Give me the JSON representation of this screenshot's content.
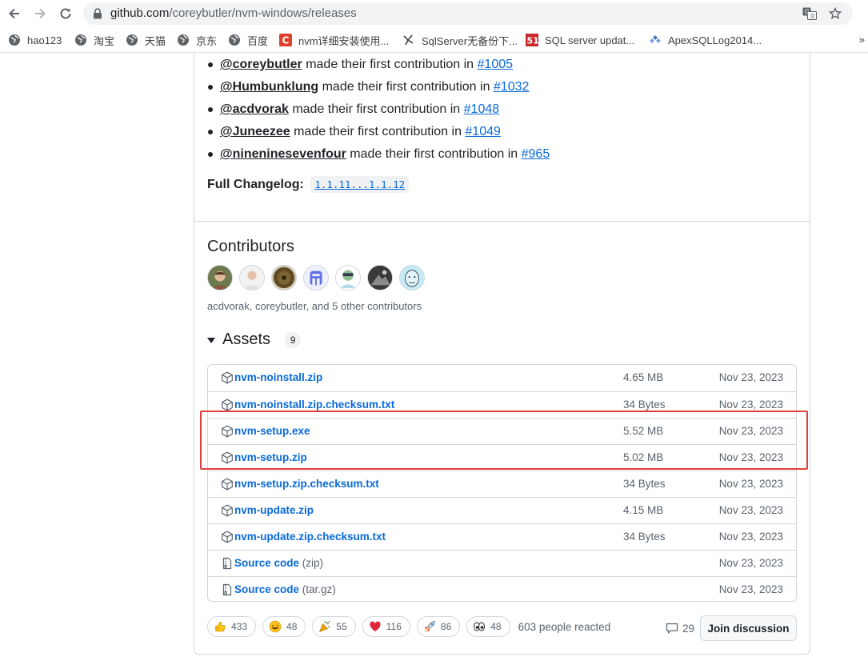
{
  "browser": {
    "url_host": "github.com",
    "url_path": "/coreybutler/nvm-windows/releases"
  },
  "bookmarks": [
    {
      "label": "hao123",
      "icon": "globe-icon"
    },
    {
      "label": "淘宝",
      "icon": "globe-icon"
    },
    {
      "label": "天猫",
      "icon": "globe-icon"
    },
    {
      "label": "京东",
      "icon": "globe-icon"
    },
    {
      "label": "百度",
      "icon": "globe-icon"
    },
    {
      "label": "nvm详细安装使用...",
      "icon": "csdn-icon"
    },
    {
      "label": "SqlServer无备份下...",
      "icon": "bird-icon"
    },
    {
      "label": "SQL server updat...",
      "icon": "51cto-icon"
    },
    {
      "label": "ApexSQLLog2014...",
      "icon": "diamonds-icon"
    }
  ],
  "bookmarks_more": "»",
  "new_contributors": [
    {
      "user": "@coreybutler",
      "text": " made their first contribution in ",
      "issue": "#1005"
    },
    {
      "user": "@Humbunklung",
      "text": " made their first contribution in ",
      "issue": "#1032"
    },
    {
      "user": "@acdvorak",
      "text": " made their first contribution in ",
      "issue": "#1048"
    },
    {
      "user": "@Juneezee",
      "text": " made their first contribution in ",
      "issue": "#1049"
    },
    {
      "user": "@nineninesevenfour",
      "text": " made their first contribution in ",
      "issue": "#965"
    }
  ],
  "changelog": {
    "label": "Full Changelog:",
    "link": "1.1.11...1.1.12"
  },
  "contributors": {
    "heading": "Contributors",
    "summary": "acdvorak, coreybutler, and 5 other contributors"
  },
  "assets": {
    "heading": "Assets",
    "count": "9",
    "items": [
      {
        "name": "nvm-noinstall.zip",
        "suffix": "",
        "size": "4.65 MB",
        "date": "Nov 23, 2023",
        "icon": "package-icon"
      },
      {
        "name": "nvm-noinstall.zip.checksum.txt",
        "suffix": "",
        "size": "34 Bytes",
        "date": "Nov 23, 2023",
        "icon": "package-icon"
      },
      {
        "name": "nvm-setup.exe",
        "suffix": "",
        "size": "5.52 MB",
        "date": "Nov 23, 2023",
        "icon": "package-icon"
      },
      {
        "name": "nvm-setup.zip",
        "suffix": "",
        "size": "5.02 MB",
        "date": "Nov 23, 2023",
        "icon": "package-icon"
      },
      {
        "name": "nvm-setup.zip.checksum.txt",
        "suffix": "",
        "size": "34 Bytes",
        "date": "Nov 23, 2023",
        "icon": "package-icon"
      },
      {
        "name": "nvm-update.zip",
        "suffix": "",
        "size": "4.15 MB",
        "date": "Nov 23, 2023",
        "icon": "package-icon"
      },
      {
        "name": "nvm-update.zip.checksum.txt",
        "suffix": "",
        "size": "34 Bytes",
        "date": "Nov 23, 2023",
        "icon": "package-icon"
      },
      {
        "name": "Source code",
        "suffix": " (zip)",
        "size": "",
        "date": "Nov 23, 2023",
        "icon": "file-zip-icon"
      },
      {
        "name": "Source code",
        "suffix": " (tar.gz)",
        "size": "",
        "date": "Nov 23, 2023",
        "icon": "file-zip-icon"
      }
    ]
  },
  "reactions": [
    {
      "emoji": "thumbs-up-icon",
      "count": "433"
    },
    {
      "emoji": "laugh-icon",
      "count": "48"
    },
    {
      "emoji": "hooray-icon",
      "count": "55"
    },
    {
      "emoji": "heart-icon",
      "count": "116"
    },
    {
      "emoji": "rocket-icon",
      "count": "86"
    },
    {
      "emoji": "eyes-icon",
      "count": "48"
    }
  ],
  "people_reacted": "603 people reacted",
  "comment_count": "29",
  "join_label": "Join discussion",
  "colors": {
    "link": "#0969da",
    "highlight": "#e0403a",
    "border": "#d0d7de"
  }
}
